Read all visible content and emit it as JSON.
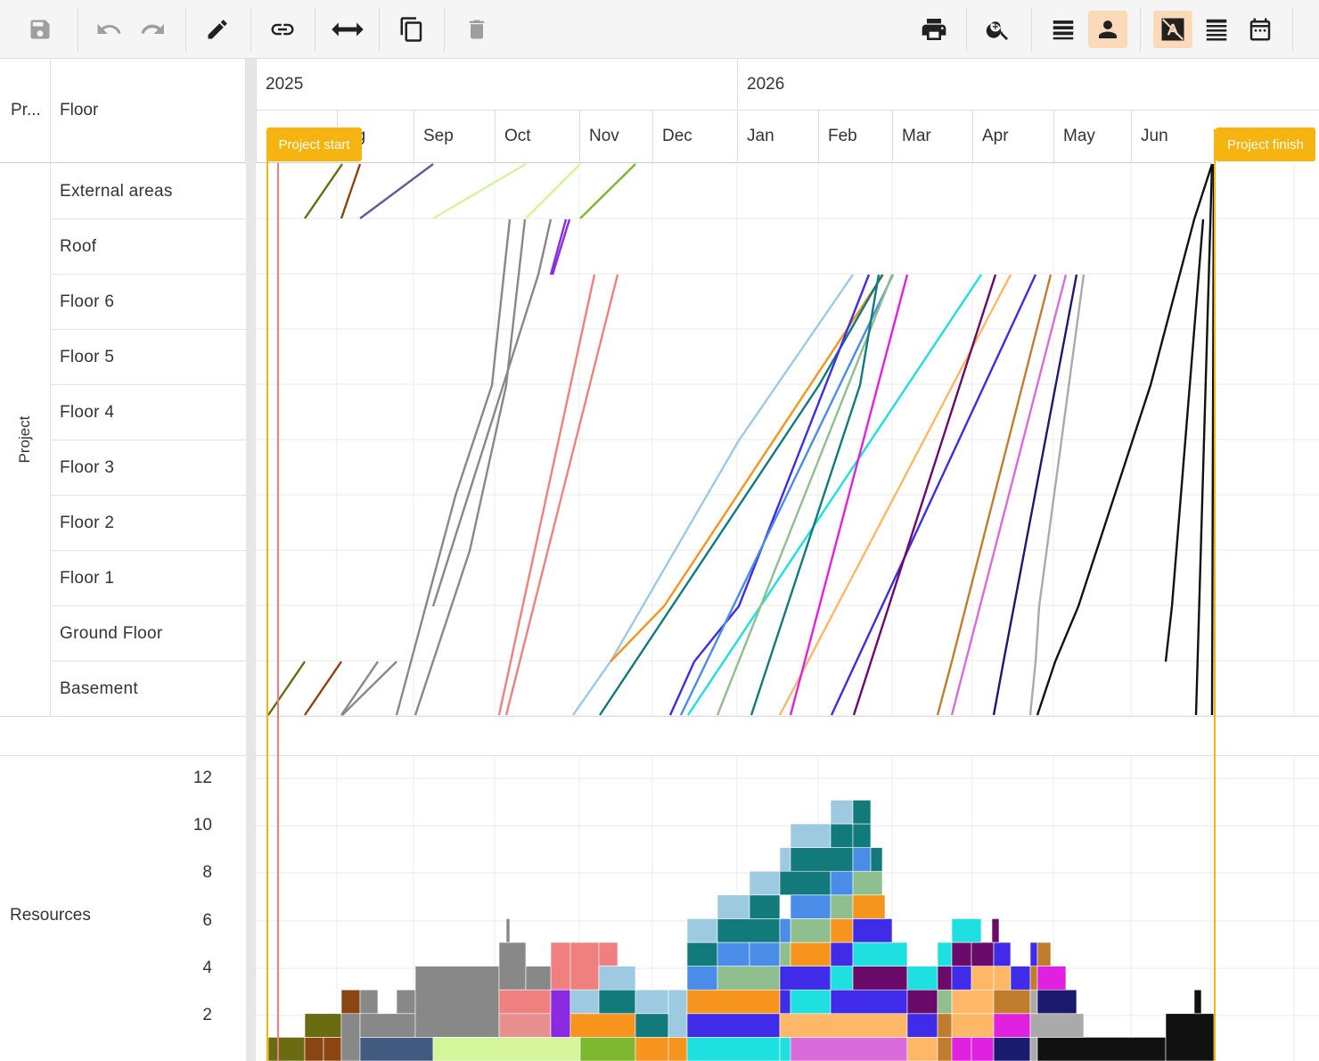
{
  "toolbar": {
    "left_icons": [
      "save-icon",
      "undo-icon",
      "redo-icon",
      "pencil-icon",
      "link-icon",
      "arrows-horizontal-icon",
      "copy-icon",
      "trash-icon"
    ],
    "right_icons": [
      "print-icon",
      "zoom-in-icon",
      "list-icon",
      "person-icon",
      "no-text-icon",
      "list-compact-icon",
      "calendar-icon"
    ],
    "active": [
      "person-icon",
      "no-text-icon"
    ]
  },
  "header": {
    "col_project": "Pr...",
    "col_floor": "Floor",
    "group_label": "Project",
    "resources_label": "Resources"
  },
  "timeline": {
    "years": [
      "2025",
      "2026"
    ],
    "months": [
      "ug",
      "Sep",
      "Oct",
      "Nov",
      "Dec",
      "Jan",
      "Feb",
      "Mar",
      "Apr",
      "May",
      "Jun"
    ],
    "start_flag": "Project start",
    "finish_flag": "Project finish"
  },
  "floors": [
    "External areas",
    "Roof",
    "Floor 6",
    "Floor 5",
    "Floor 4",
    "Floor 3",
    "Floor 2",
    "Floor 1",
    "Ground Floor",
    "Basement"
  ],
  "resource_axis": [
    "12",
    "10",
    "8",
    "6",
    "4",
    "2"
  ]
}
